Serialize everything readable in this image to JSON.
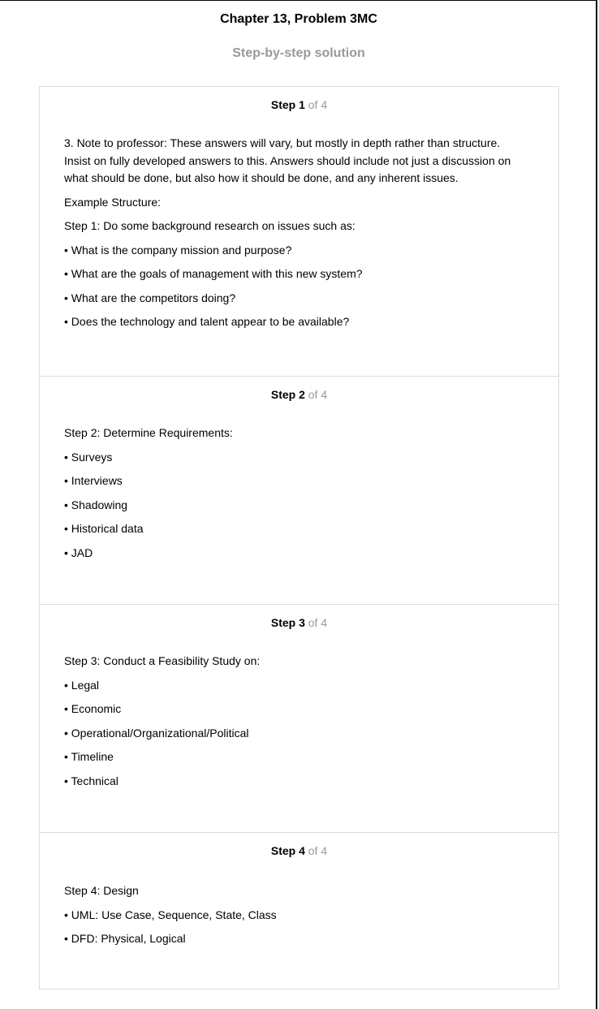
{
  "page": {
    "title": "Chapter 13, Problem 3MC",
    "subtitle": "Step-by-step solution"
  },
  "steps": [
    {
      "label": "Step 1",
      "of": "of 4",
      "paragraphs": [
        "3. Note to professor: These answers will vary, but mostly in depth rather than structure. Insist on fully developed answers to this. Answers should include not just a discussion on what should be done, but also how it should be done, and any inherent issues.",
        "Example Structure:",
        "Step 1: Do some background research on issues such as:",
        "• What is the company mission and purpose?",
        "• What are the goals of management with this new system?",
        "• What are the competitors doing?",
        "• Does the technology and talent appear to be available?"
      ]
    },
    {
      "label": "Step 2",
      "of": "of 4",
      "paragraphs": [
        "Step 2: Determine Requirements:",
        "• Surveys",
        "• Interviews",
        "• Shadowing",
        "• Historical data",
        "• JAD"
      ]
    },
    {
      "label": "Step 3",
      "of": "of 4",
      "paragraphs": [
        "Step 3: Conduct a Feasibility Study on:",
        "• Legal",
        "• Economic",
        "• Operational/Organizational/Political",
        "• Timeline",
        "• Technical"
      ]
    },
    {
      "label": "Step 4",
      "of": "of 4",
      "paragraphs": [
        "Step 4: Design",
        "• UML: Use Case, Sequence, State, Class",
        "• DFD: Physical, Logical"
      ]
    }
  ]
}
